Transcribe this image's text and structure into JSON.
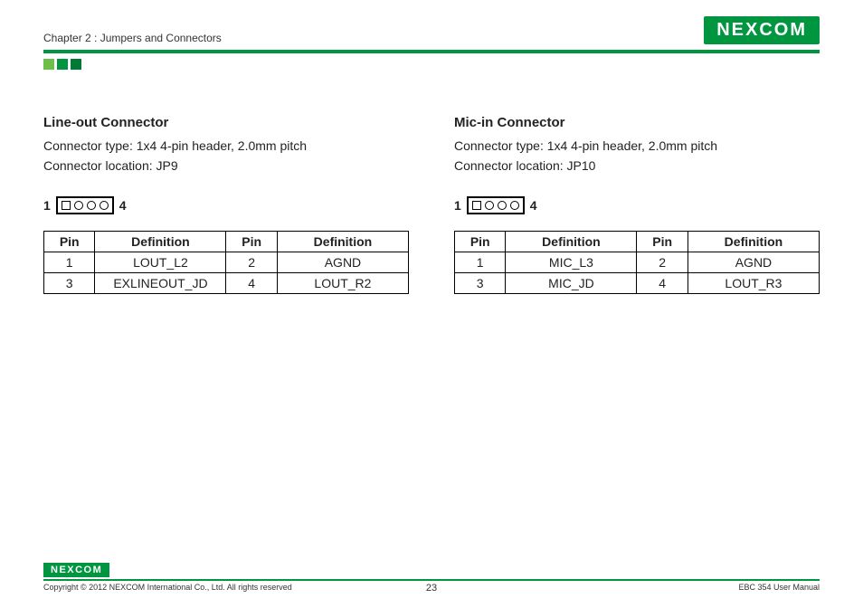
{
  "header": {
    "chapter": "Chapter 2 : Jumpers and Connectors",
    "logo_text": "NEXCOM"
  },
  "left": {
    "title": "Line-out Connector",
    "type_line": "Connector type: 1x4 4-pin header, 2.0mm pitch",
    "loc_line": "Connector location: JP9",
    "diagram": {
      "start": "1",
      "end": "4"
    },
    "table": {
      "headers": [
        "Pin",
        "Definition",
        "Pin",
        "Definition"
      ],
      "rows": [
        [
          "1",
          "LOUT_L2",
          "2",
          "AGND"
        ],
        [
          "3",
          "EXLINEOUT_JD",
          "4",
          "LOUT_R2"
        ]
      ]
    }
  },
  "right": {
    "title": "Mic-in Connector",
    "type_line": "Connector type: 1x4 4-pin header, 2.0mm pitch",
    "loc_line": "Connector location: JP10",
    "diagram": {
      "start": "1",
      "end": "4"
    },
    "table": {
      "headers": [
        "Pin",
        "Definition",
        "Pin",
        "Definition"
      ],
      "rows": [
        [
          "1",
          "MIC_L3",
          "2",
          "AGND"
        ],
        [
          "3",
          "MIC_JD",
          "4",
          "LOUT_R3"
        ]
      ]
    }
  },
  "footer": {
    "logo_text": "NEXCOM",
    "copyright": "Copyright © 2012 NEXCOM International Co., Ltd. All rights reserved",
    "page_number": "23",
    "doc_title": "EBC 354 User Manual"
  }
}
